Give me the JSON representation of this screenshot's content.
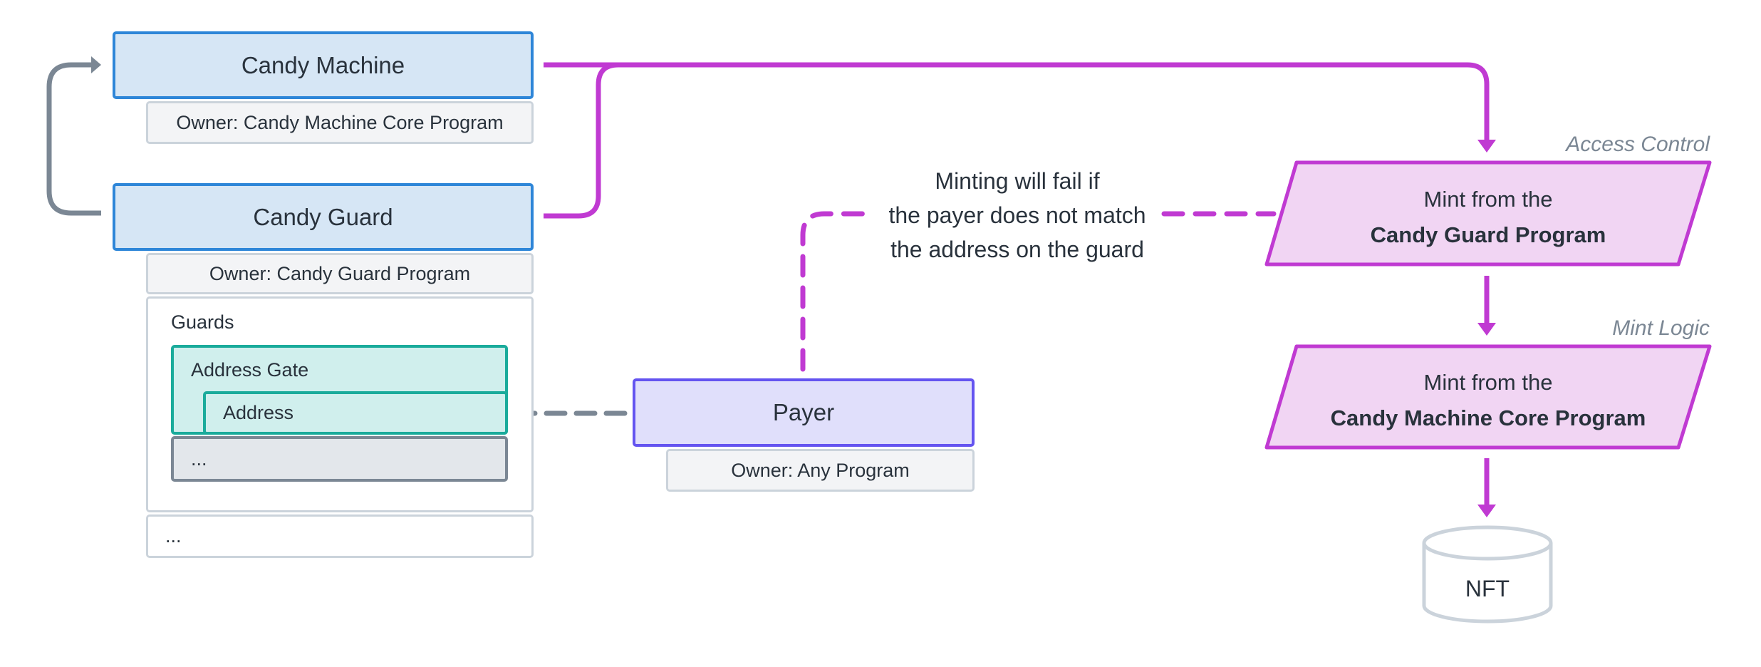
{
  "colors": {
    "magenta": "#c03ad2",
    "magenta_fill": "#f1d5f3",
    "account_fill": "#d6e6f5",
    "account_border": "#2e86d8",
    "guard_fill": "#d0efed",
    "guard_border": "#1aab9b",
    "payer_fill": "#e0dffb",
    "payer_border": "#6454f0",
    "grey": "#7b8794",
    "text": "#29323c"
  },
  "candy_machine": {
    "title": "Candy Machine",
    "owner": "Owner: Candy Machine Core Program"
  },
  "candy_guard": {
    "title": "Candy Guard",
    "owner": "Owner: Candy Guard Program",
    "guards_label": "Guards",
    "address_gate": "Address Gate",
    "address": "Address",
    "more_guards": "...",
    "more_fields": "..."
  },
  "payer": {
    "title": "Payer",
    "owner": "Owner: Any Program"
  },
  "note": {
    "line1": "Minting will fail if",
    "line2": "the payer does not match",
    "line3": "the address on the guard"
  },
  "steps": [
    {
      "label": "Access Control",
      "line1": "Mint from the",
      "line2": "Candy Guard Program"
    },
    {
      "label": "Mint Logic",
      "line1": "Mint from the",
      "line2": "Candy Machine Core Program"
    }
  ],
  "nft": {
    "label": "NFT"
  }
}
